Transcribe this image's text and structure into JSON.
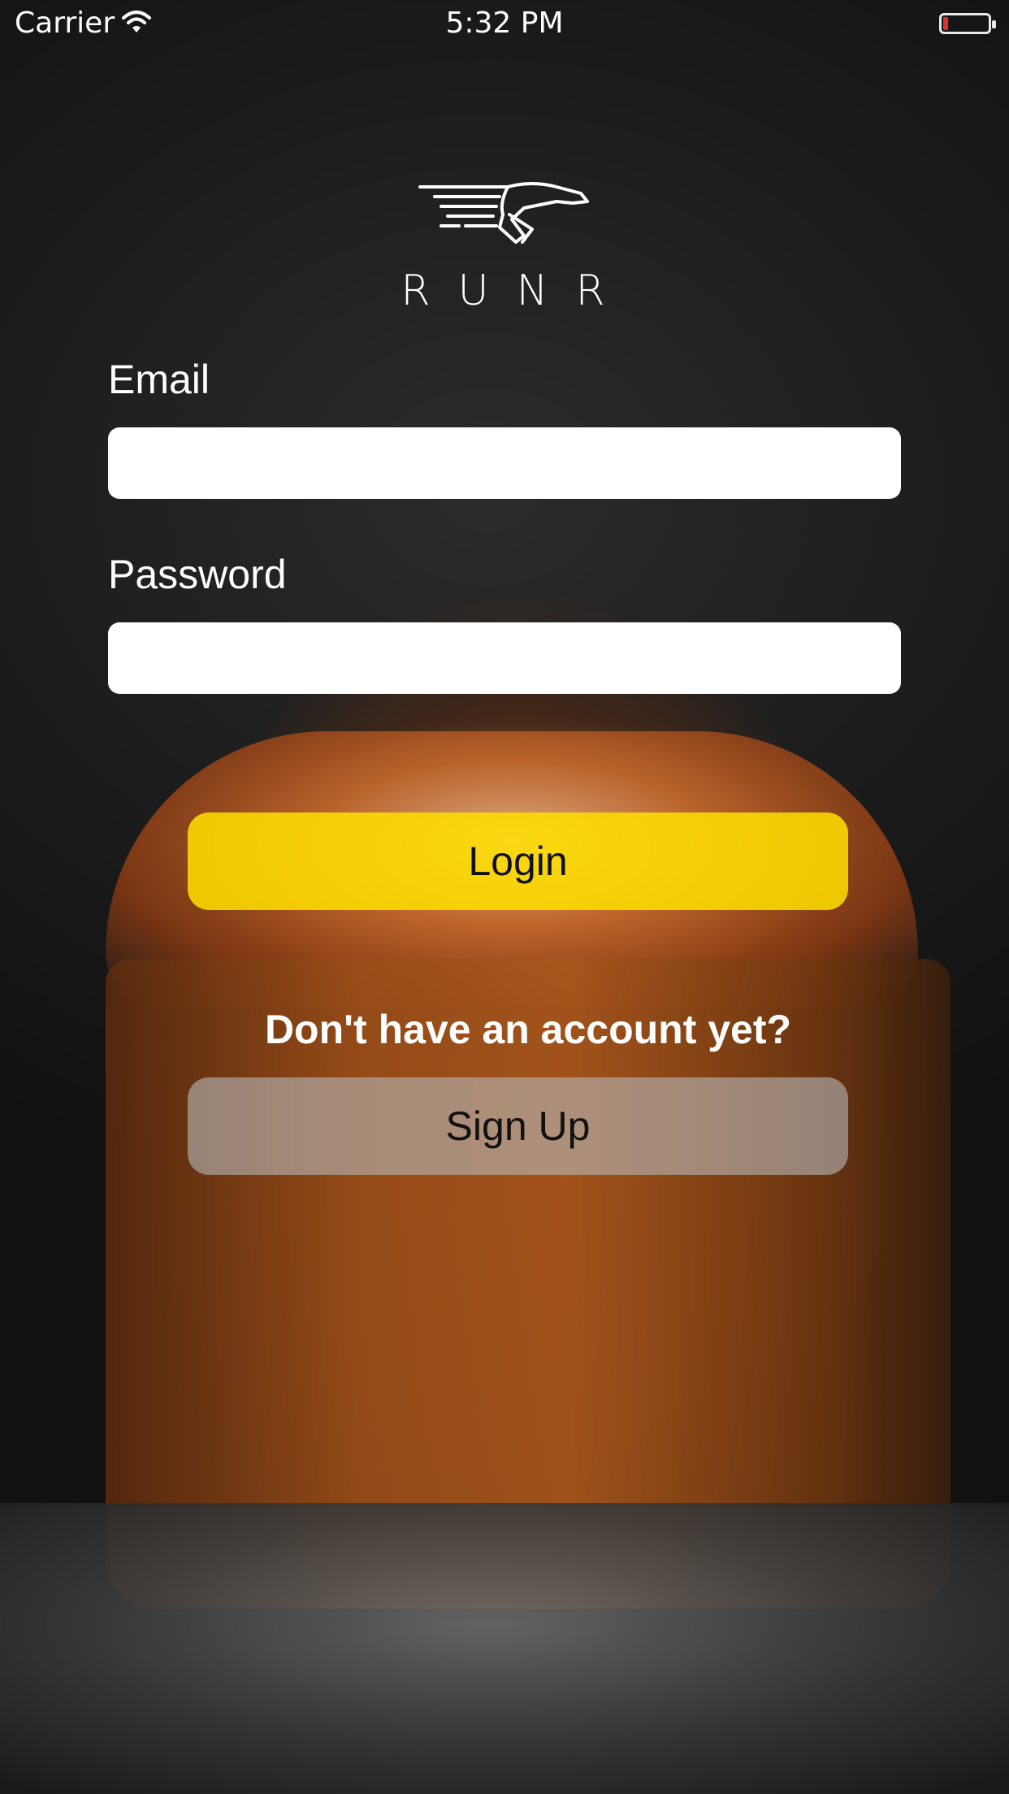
{
  "status_bar": {
    "carrier": "Carrier",
    "time": "5:32 PM",
    "battery_color": "#e03030"
  },
  "logo": {
    "icon": "runner-logo-icon",
    "text": "RUNR"
  },
  "form": {
    "email_label": "Email",
    "email_value": "",
    "password_label": "Password",
    "password_value": ""
  },
  "buttons": {
    "login_label": "Login",
    "login_color": "#ffe000",
    "signup_prompt": "Don't have an account yet?",
    "signup_label": "Sign Up"
  }
}
